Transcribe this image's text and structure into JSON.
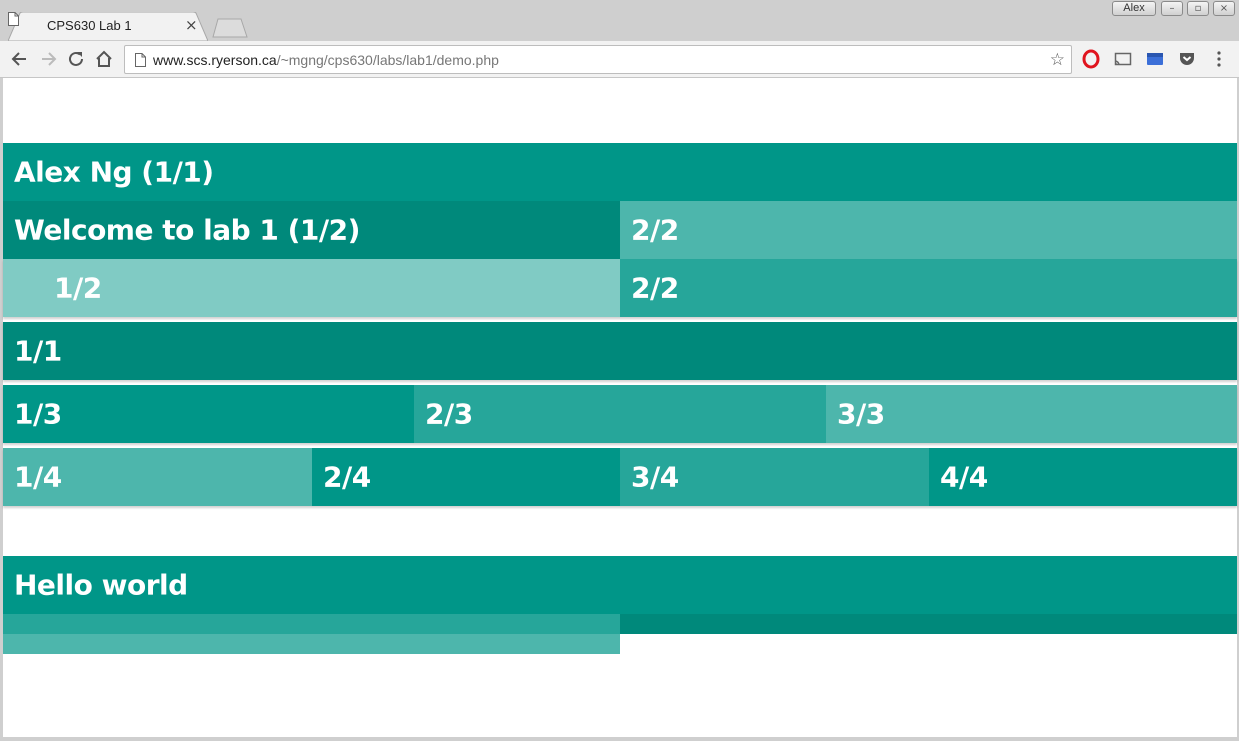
{
  "browser": {
    "tab_title": "CPS630 Lab 1",
    "tab_close": "×",
    "profile_name": "Alex",
    "url_host": "www.scs.ryerson.ca",
    "url_path": "/~mgng/cps630/labs/lab1/demo.php",
    "star": "☆",
    "icons": [
      "page-icon",
      "back-icon",
      "forward-icon",
      "reload-icon",
      "home-icon",
      "star-icon",
      "opera-icon",
      "cast-icon",
      "extension-icon",
      "pocket-icon",
      "menu-icon"
    ]
  },
  "page": {
    "header_row": {
      "text": "Alex Ng (1/1)",
      "color": "#009688"
    },
    "row2": [
      {
        "text": "Welcome to lab 1 (1/2)",
        "color": "#00897B"
      },
      {
        "text": "2/2",
        "color": "#4DB6AC"
      }
    ],
    "row3": [
      {
        "text": "1/2",
        "color": "#80CBC4"
      },
      {
        "text": "2/2",
        "color": "#26A69A"
      }
    ],
    "row4": [
      {
        "text": "1/1",
        "color": "#00897B"
      }
    ],
    "row5": [
      {
        "text": "1/3",
        "color": "#009688"
      },
      {
        "text": "2/3",
        "color": "#26A69A"
      },
      {
        "text": "3/3",
        "color": "#4DB6AC"
      }
    ],
    "row6": [
      {
        "text": "1/4",
        "color": "#4DB6AC"
      },
      {
        "text": "2/4",
        "color": "#009688"
      },
      {
        "text": "3/4",
        "color": "#26A69A"
      },
      {
        "text": "4/4",
        "color": "#009688"
      }
    ],
    "hello_row": {
      "text": "Hello world",
      "color": "#009688"
    },
    "strip_colors": [
      "#26A69A",
      "#00897B",
      "#4DB6AC"
    ]
  }
}
